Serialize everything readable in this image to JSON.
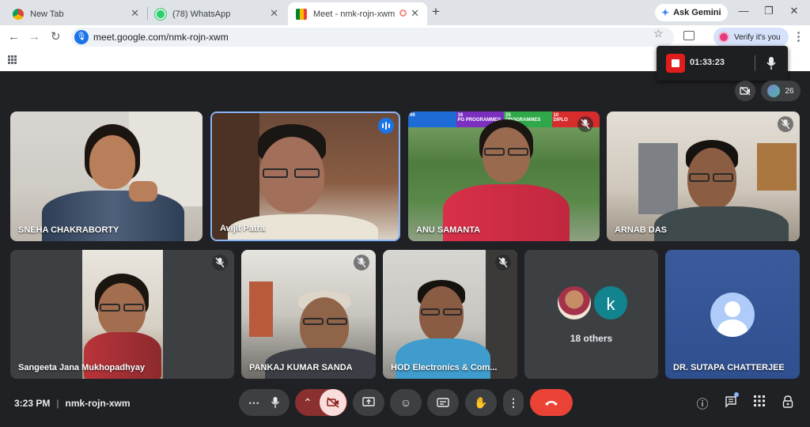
{
  "browser": {
    "tabs": [
      {
        "title": "New Tab",
        "favicon": "chrome-icon"
      },
      {
        "title": "(78) WhatsApp",
        "favicon": "whatsapp-icon"
      },
      {
        "title": "Meet - nmk-rojn-xwm",
        "favicon": "meet-icon",
        "active": true
      }
    ],
    "ask_gemini": "Ask Gemini",
    "url": "meet.google.com/nmk-rojn-xwm",
    "verify_label": "Verify it's you"
  },
  "recording": {
    "elapsed": "01:33:23"
  },
  "meeting": {
    "participant_count": "26",
    "tiles": [
      {
        "name": "SNEHA CHAKRABORTY",
        "muted": false
      },
      {
        "name": "Avijit Patra",
        "muted": false,
        "speaking": true
      },
      {
        "name": "ANU SAMANTA",
        "muted": true
      },
      {
        "name": "ARNAB DAS",
        "muted": true
      },
      {
        "name": "Sangeeta Jana Mukhopadhyay",
        "muted": true
      },
      {
        "name": "PANKAJ KUMAR SANDA",
        "muted": true
      },
      {
        "name": "HOD Electronics & Com...",
        "muted": true
      },
      {
        "name": "18 others",
        "avatar_letter": "k"
      },
      {
        "name": "DR. SUTAPA CHATTERJEE"
      }
    ],
    "banner": {
      "num1": "06",
      "num2": "16",
      "num3": "25",
      "num4": "10",
      "lbl2": "PG PROGRAMMES",
      "lbl3": "PROGRAMMES",
      "lbl4": "DIPLO"
    }
  },
  "footer": {
    "time": "3:23 PM",
    "separator": "|",
    "meeting_code": "nmk-rojn-xwm"
  },
  "colors": {
    "end_call": "#ea4335",
    "record": "#e01c1c",
    "speaking": "#1a73e8"
  }
}
